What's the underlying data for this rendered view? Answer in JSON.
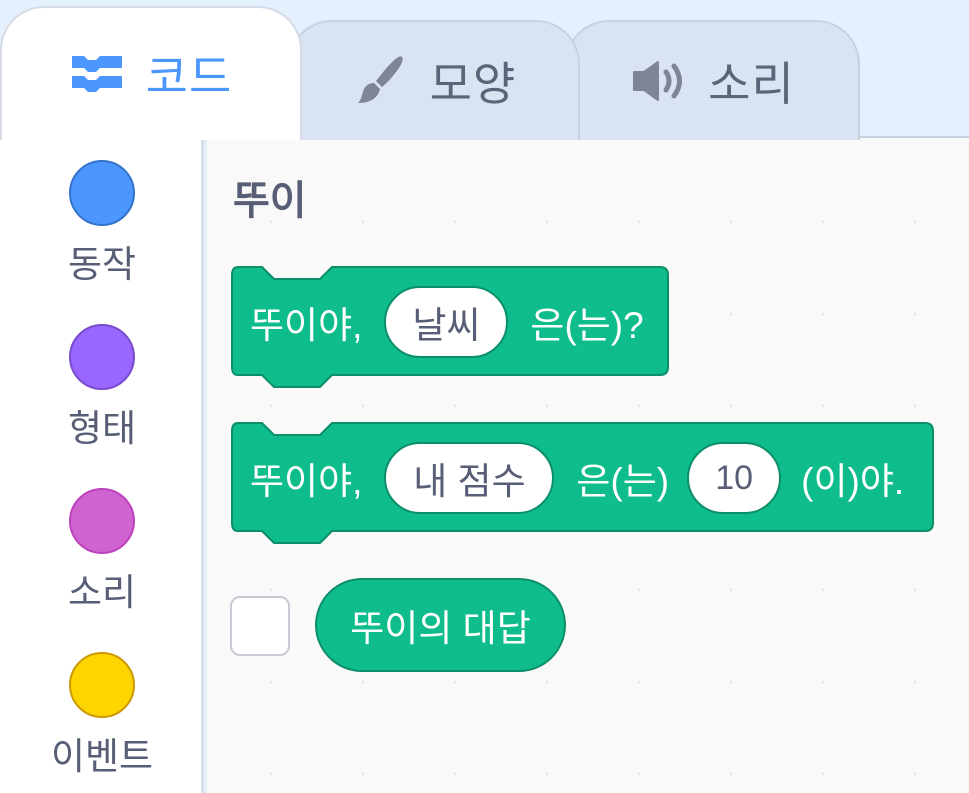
{
  "tabs": [
    {
      "label": "코드",
      "icon": "code-blocks-icon",
      "active": true
    },
    {
      "label": "모양",
      "icon": "paintbrush-icon",
      "active": false
    },
    {
      "label": "소리",
      "icon": "speaker-icon",
      "active": false
    }
  ],
  "categories": [
    {
      "label": "동작",
      "color": "#4c97ff",
      "border": "#3373cc"
    },
    {
      "label": "형태",
      "color": "#9966ff",
      "border": "#774dcb"
    },
    {
      "label": "소리",
      "color": "#cf63cf",
      "border": "#bd42bd"
    },
    {
      "label": "이벤트",
      "color": "#ffd500",
      "border": "#cc9900"
    }
  ],
  "palette": {
    "section_title": "뚜이",
    "block_color": "#0fbd8c",
    "blocks": {
      "ask": {
        "prefix": "뚜이야,",
        "input": "날씨",
        "suffix": "은(는)?"
      },
      "set": {
        "prefix": "뚜이야,",
        "input_a": "내 점수",
        "middle": "은(는)",
        "input_b": "10",
        "suffix": "(이)야."
      },
      "reporter": {
        "label": "뚜이의 대답",
        "checked": false
      }
    }
  }
}
